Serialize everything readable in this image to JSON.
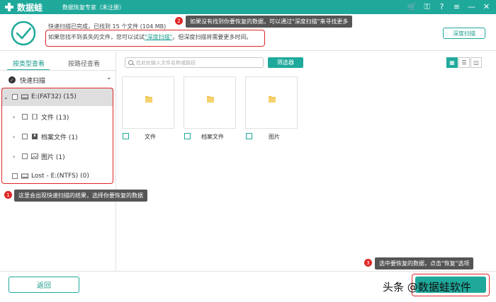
{
  "app": {
    "name": "数据蛙",
    "subtitle": "数据恢复专家（未注册）"
  },
  "colors": {
    "accent": "#1fa99b",
    "annotation": "#e02626"
  },
  "status": {
    "line1": "快速扫描已完成，已找到 15 个文件 (104 MB)",
    "line2_prefix": "如果您找不到丢失的文件，您可以试试",
    "line2_link": "\"深度扫描\"",
    "line2_suffix": "。但深度扫描将需要更多时间。",
    "deep_scan_button": "深度扫描"
  },
  "tabs": [
    {
      "label": "按类型查看",
      "active": true
    },
    {
      "label": "按路径查看",
      "active": false
    }
  ],
  "quick_scan_label": "快速扫描",
  "tree": [
    {
      "label": "E:(FAT32) (15)",
      "icon": "drive-icon",
      "expanded": true,
      "selected": true
    },
    {
      "label": "文件 (13)",
      "icon": "document-icon"
    },
    {
      "label": "档案文件 (1)",
      "icon": "archive-icon"
    },
    {
      "label": "图片 (1)",
      "icon": "image-icon"
    },
    {
      "label": "Lost - E:(NTFS) (0)",
      "icon": "drive-icon"
    }
  ],
  "search_placeholder": "在此处输入文件名称或路径",
  "filter_button": "筛选器",
  "cards": [
    {
      "label": "文件"
    },
    {
      "label": "档案文件"
    },
    {
      "label": "图片"
    }
  ],
  "annotations": {
    "n1": {
      "badge": "1",
      "text": "这里会出现快速扫描的结果，选择你要恢复的数据"
    },
    "n2": {
      "badge": "2",
      "text": "如果没有找到你要恢复的数据，可以通过\"深度扫描\"来寻找更多"
    },
    "n3": {
      "badge": "3",
      "text": "选中要恢复的数据，点击\"恢复\"选项"
    }
  },
  "back_button": "返回",
  "watermark": "头条 @数据蛙软件"
}
